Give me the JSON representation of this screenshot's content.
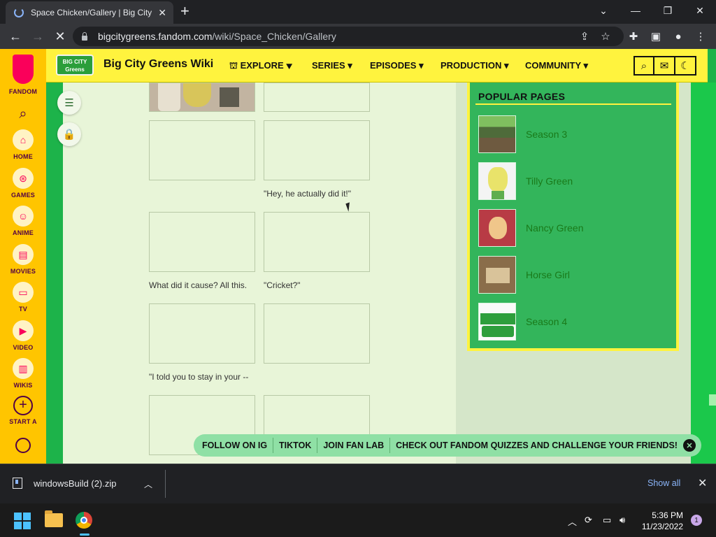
{
  "browser": {
    "tab_title": "Space Chicken/Gallery | Big City G",
    "url_host": "bigcitygreens.fandom.com",
    "url_path": "/wiki/Space_Chicken/Gallery"
  },
  "fandom_rail": {
    "brand": "FANDOM",
    "items": [
      {
        "label": "HOME",
        "icon": "home-icon"
      },
      {
        "label": "GAMES",
        "icon": "gamepad-icon"
      },
      {
        "label": "ANIME",
        "icon": "anime-icon"
      },
      {
        "label": "MOVIES",
        "icon": "clapperboard-icon"
      },
      {
        "label": "TV",
        "icon": "tv-icon"
      },
      {
        "label": "VIDEO",
        "icon": "play-icon"
      },
      {
        "label": "WIKIS",
        "icon": "book-icon"
      },
      {
        "label": "START A",
        "icon": "plus-circle-icon"
      }
    ]
  },
  "wiki_header": {
    "logo_text": "BIG CITY Greens",
    "wiki_name": "Big City Greens Wiki",
    "nav": [
      "EXPLORE",
      "SERIES",
      "EPISODES",
      "PRODUCTION",
      "COMMUNITY"
    ]
  },
  "gallery": {
    "captions": [
      "\"Hey, he actually did it!\"",
      "What did it cause? All this.",
      "\"Cricket?\"",
      "\"I told you to stay in your --"
    ]
  },
  "popular_pages": {
    "title": "POPULAR PAGES",
    "items": [
      "Season 3",
      "Tilly Green",
      "Nancy Green",
      "Horse Girl",
      "Season 4"
    ]
  },
  "promo_bar": {
    "items": [
      "FOLLOW ON IG",
      "TIKTOK",
      "JOIN FAN LAB",
      "CHECK OUT FANDOM QUIZZES AND CHALLENGE YOUR FRIENDS!"
    ]
  },
  "downloads": {
    "file_name": "windowsBuild (2).zip",
    "show_all": "Show all"
  },
  "taskbar": {
    "time": "5:36 PM",
    "date": "11/23/2022",
    "notifications": "1"
  }
}
